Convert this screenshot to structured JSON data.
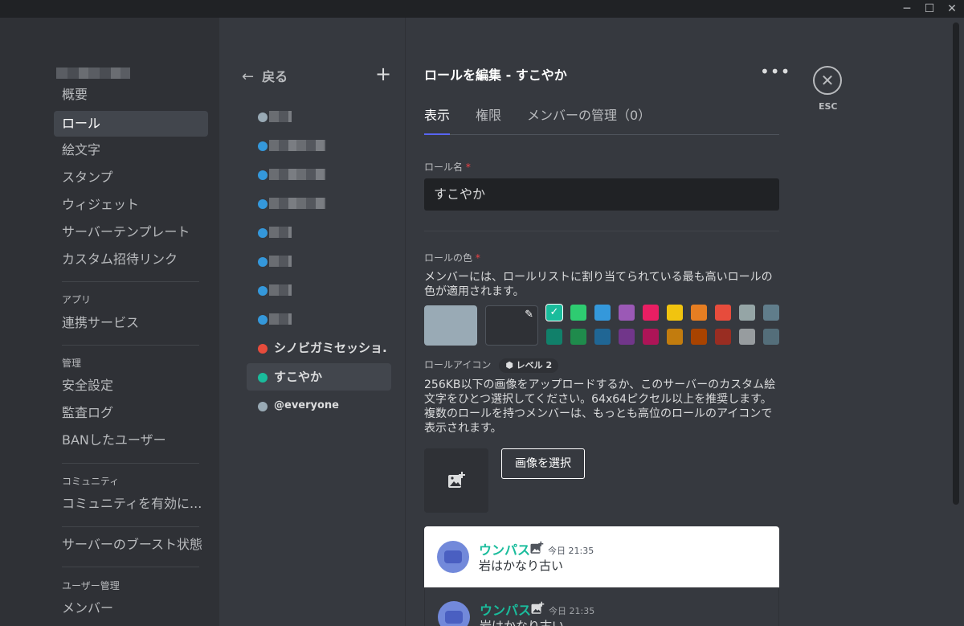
{
  "window": {
    "minimize_label": "─",
    "maximize_label": "☐",
    "close_label": "✕"
  },
  "sidebar": {
    "items": [
      {
        "label": "概要"
      },
      {
        "label": "ロール"
      },
      {
        "label": "絵文字"
      },
      {
        "label": "スタンプ"
      },
      {
        "label": "ウィジェット"
      },
      {
        "label": "サーバーテンプレート"
      },
      {
        "label": "カスタム招待リンク"
      }
    ],
    "app_section": {
      "heading": "アプリ",
      "items": [
        {
          "label": "連携サービス"
        }
      ]
    },
    "manage_section": {
      "heading": "管理",
      "items": [
        {
          "label": "安全設定"
        },
        {
          "label": "監査ログ"
        },
        {
          "label": "BANしたユーザー"
        }
      ]
    },
    "community_section": {
      "heading": "コミュニティ",
      "items": [
        {
          "label": "コミュニティを有効に..."
        }
      ]
    },
    "boost_item": {
      "label": "サーバーのブースト状態"
    },
    "user_section": {
      "heading": "ユーザー管理",
      "items": [
        {
          "label": "メンバー"
        }
      ]
    }
  },
  "roles": {
    "back_label": "戻る",
    "add_label": "+",
    "list": [
      {
        "name": "",
        "color": "#99aab5"
      },
      {
        "name": "",
        "color": "#3498db"
      },
      {
        "name": "",
        "color": "#3498db"
      },
      {
        "name": "",
        "color": "#3498db"
      },
      {
        "name": "",
        "color": "#3498db"
      },
      {
        "name": "",
        "color": "#3498db"
      },
      {
        "name": "",
        "color": "#3498db"
      },
      {
        "name": "",
        "color": "#3498db"
      },
      {
        "name": "シノビガミセッショ...",
        "color": "#e74c3c"
      },
      {
        "name": "すこやか",
        "color": "#1abc9c"
      },
      {
        "name": "@everyone",
        "color": "#99aab5"
      }
    ]
  },
  "editor": {
    "title": "ロールを編集 - すこやか",
    "more_label": "•••",
    "tabs": [
      {
        "label": "表示"
      },
      {
        "label": "権限"
      },
      {
        "label": "メンバーの管理（0）"
      }
    ],
    "role_name_label": "ロール名",
    "required_mark": "*",
    "role_name_value": "すこやか",
    "role_color_label": "ロールの色",
    "role_color_desc": "メンバーには、ロールリストに割り当てられている最も高いロールの色が適用されます。",
    "selected_color": "#99aab5",
    "colors_row1": [
      "#1abc9c",
      "#2ecc71",
      "#3498db",
      "#9b59b6",
      "#e91e63",
      "#f1c40f",
      "#e67e22",
      "#e74c3c",
      "#95a5a6",
      "#607d8b"
    ],
    "colors_row2": [
      "#11806a",
      "#1f8b4c",
      "#206694",
      "#71368a",
      "#ad1457",
      "#c27c0e",
      "#a84300",
      "#992d22",
      "#979c9f",
      "#546e7a"
    ],
    "role_icon_label": "ロールアイコン",
    "level_badge": "レベル 2",
    "role_icon_desc": "256KB以下の画像をアップロードするか、このサーバーのカスタム絵文字をひとつ選択してください。64x64ピクセル以上を推奨します。複数のロールを持つメンバーは、もっとも高位のロールのアイコンで表示されます。",
    "choose_image_label": "画像を選択",
    "preview": {
      "username": "ウンパス",
      "time": "今日 21:35",
      "message": "岩はかなり古い"
    }
  },
  "esc": {
    "icon": "✕",
    "label": "ESC"
  }
}
